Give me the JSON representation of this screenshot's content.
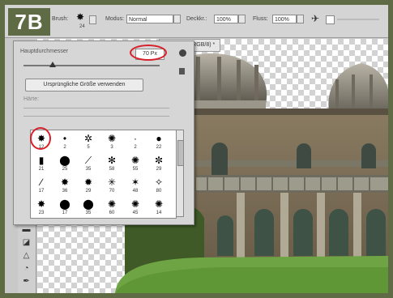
{
  "badge": {
    "label": "7B",
    "color": "#5f6b45"
  },
  "options_bar": {
    "brush_label": "Brush:",
    "brush_size": "24",
    "mode_label": "Modus:",
    "mode_value": "Normal",
    "opacity_label": "Deckkr.:",
    "opacity_value": "100%",
    "flow_label": "Fluss:",
    "flow_value": "100%"
  },
  "document": {
    "tab_title": "Pavilion 5, RGB/8) *"
  },
  "brush_panel": {
    "diameter_label": "Hauptdurchmesser",
    "diameter_value": "70 Px",
    "sample_button": "Ursprüngliche Größe verwenden",
    "hardness_label": "Härte:",
    "brushes": [
      {
        "glyph": "✸",
        "size": "12"
      },
      {
        "glyph": "•",
        "size": "2"
      },
      {
        "glyph": "✲",
        "size": "5"
      },
      {
        "glyph": "✺",
        "size": "3"
      },
      {
        "glyph": "·",
        "size": "2"
      },
      {
        "glyph": "●",
        "size": "22"
      },
      {
        "glyph": "▮",
        "size": "21"
      },
      {
        "glyph": "⬤",
        "size": "25"
      },
      {
        "glyph": "⟋",
        "size": "35"
      },
      {
        "glyph": "✻",
        "size": "58"
      },
      {
        "glyph": "✺",
        "size": "55"
      },
      {
        "glyph": "✼",
        "size": "29"
      },
      {
        "glyph": "∕",
        "size": "17"
      },
      {
        "glyph": "✸",
        "size": "36"
      },
      {
        "glyph": "✹",
        "size": "29"
      },
      {
        "glyph": "✳",
        "size": "70"
      },
      {
        "glyph": "✶",
        "size": "48"
      },
      {
        "glyph": "✧",
        "size": "80"
      },
      {
        "glyph": "✸",
        "size": "23"
      },
      {
        "glyph": "⬤",
        "size": "17"
      },
      {
        "glyph": "⬤",
        "size": "35"
      },
      {
        "glyph": "✺",
        "size": "60"
      },
      {
        "glyph": "✺",
        "size": "45"
      },
      {
        "glyph": "✺",
        "size": "14"
      }
    ]
  },
  "colors": {
    "accent_red": "#d8202a",
    "frame_green": "#5f6b45"
  }
}
